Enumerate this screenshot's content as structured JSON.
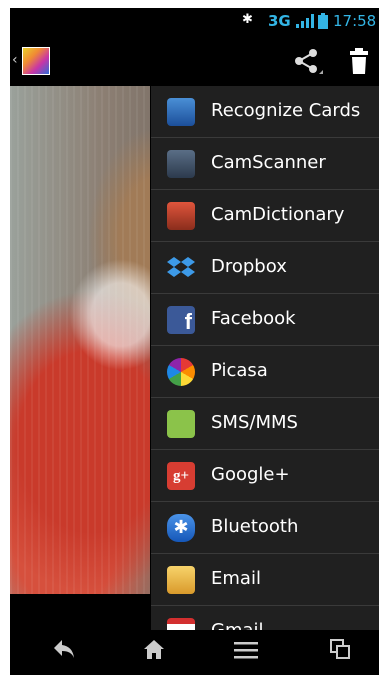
{
  "status_bar": {
    "bluetooth_glyph": "✱",
    "network": "3G",
    "time": "17:58",
    "accent_color": "#33b5e5"
  },
  "action_bar": {
    "app_icon": "gallery-icon",
    "share_icon": "share-icon",
    "delete_icon": "trash-icon"
  },
  "share_menu": {
    "items": [
      {
        "label": "Recognize Cards",
        "icon": "recognize-cards-icon"
      },
      {
        "label": "CamScanner",
        "icon": "camscanner-icon"
      },
      {
        "label": "CamDictionary",
        "icon": "camdictionary-icon"
      },
      {
        "label": "Dropbox",
        "icon": "dropbox-icon"
      },
      {
        "label": "Facebook",
        "icon": "facebook-icon"
      },
      {
        "label": "Picasa",
        "icon": "picasa-icon"
      },
      {
        "label": "SMS/MMS",
        "icon": "sms-icon"
      },
      {
        "label": "Google+",
        "icon": "google-plus-icon"
      },
      {
        "label": "Bluetooth",
        "icon": "bluetooth-icon"
      },
      {
        "label": "Email",
        "icon": "email-icon"
      },
      {
        "label": "Gmail",
        "icon": "gmail-icon"
      }
    ]
  },
  "nav_bar": {
    "back": "back-icon",
    "home": "home-icon",
    "menu": "menu-icon",
    "recents": "recents-icon"
  }
}
